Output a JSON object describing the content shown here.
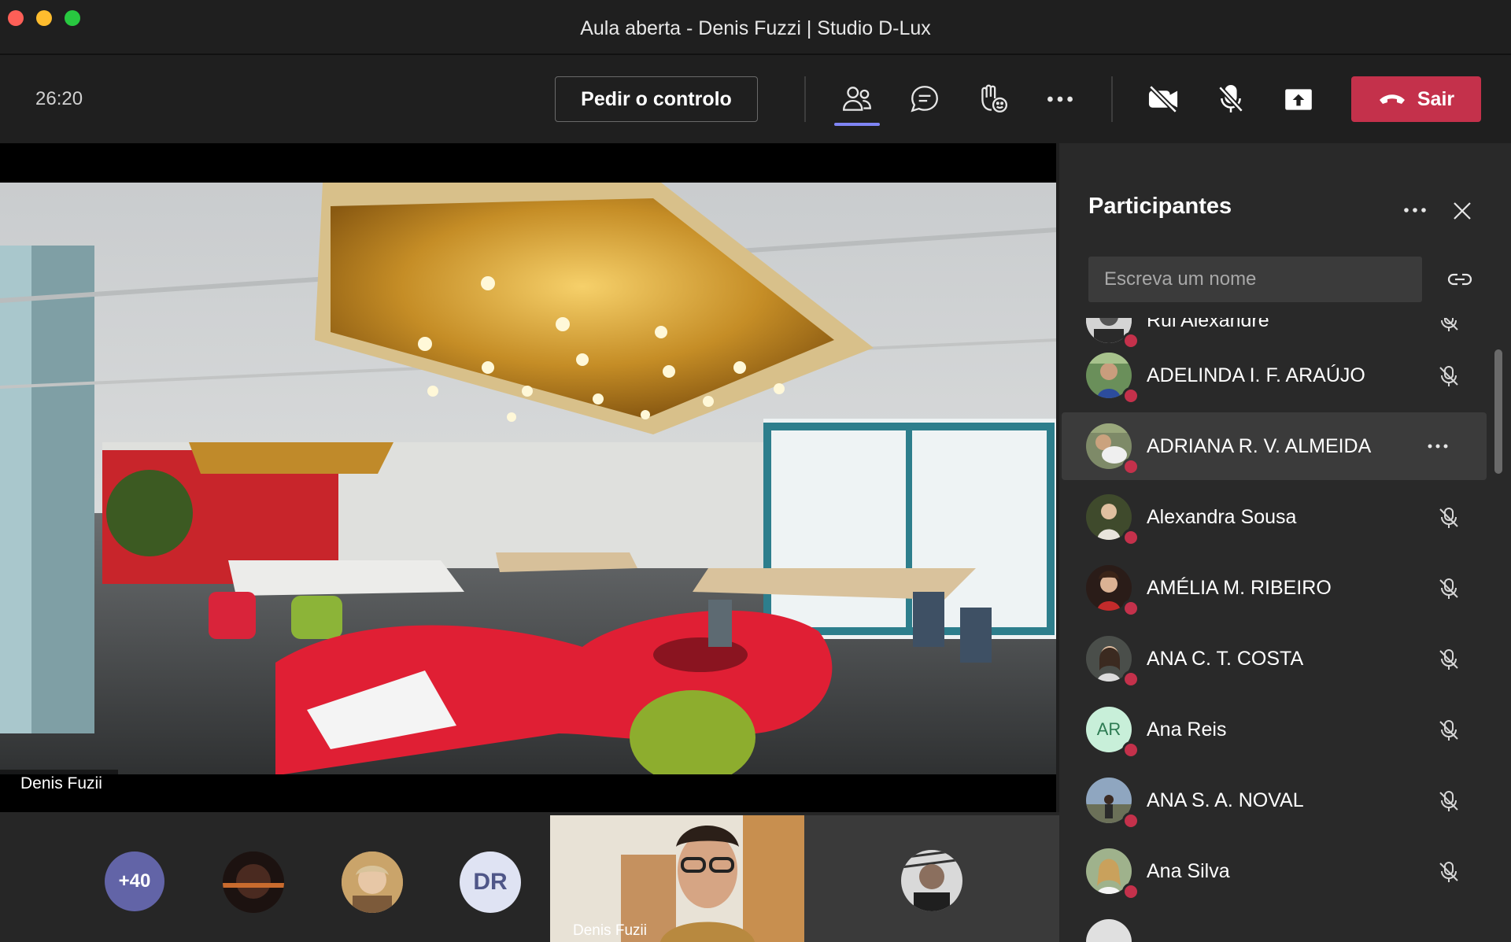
{
  "window": {
    "title": "Aula aberta - Denis Fuzzi | Studio D-Lux"
  },
  "toolbar": {
    "timer": "26:20",
    "request_control_label": "Pedir o controlo",
    "icons": [
      "people-icon",
      "chat-icon",
      "raise-hand-icon",
      "more-icon",
      "camera-off-icon",
      "mic-off-icon",
      "share-tray-icon"
    ],
    "leave_label": "Sair",
    "leave_color": "#c4314b",
    "active_color": "#7f85f5"
  },
  "stage": {
    "presenter_name": "Denis Fuzii"
  },
  "filmstrip": {
    "overflow_count": "+40",
    "initials": "DR",
    "video_label": "Denis Fuzii"
  },
  "participants": {
    "title": "Participantes",
    "search_placeholder": "Escreva um nome",
    "items": [
      {
        "name": "Rui Alexandre",
        "muted": true
      },
      {
        "name": "ADELINDA I. F. ARAÚJO",
        "muted": true
      },
      {
        "name": "ADRIANA R. V. ALMEIDA",
        "muted": false,
        "selected": true
      },
      {
        "name": "Alexandra Sousa",
        "muted": true
      },
      {
        "name": "AMÉLIA M. RIBEIRO",
        "muted": true
      },
      {
        "name": "ANA C. T. COSTA",
        "muted": true
      },
      {
        "name": "Ana Reis",
        "initials": "AR",
        "muted": true
      },
      {
        "name": "ANA S. A. NOVAL",
        "muted": true
      },
      {
        "name": "Ana Silva",
        "muted": true
      }
    ]
  }
}
